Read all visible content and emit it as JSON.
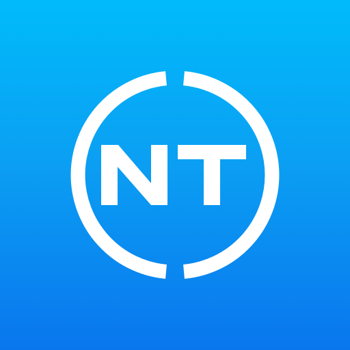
{
  "icon": {
    "name": "NT app icon",
    "letters": "NT",
    "colors": {
      "background_top": "#00BBFB",
      "background_bottom": "#0976EE",
      "foreground": "#FFFFFF"
    }
  }
}
